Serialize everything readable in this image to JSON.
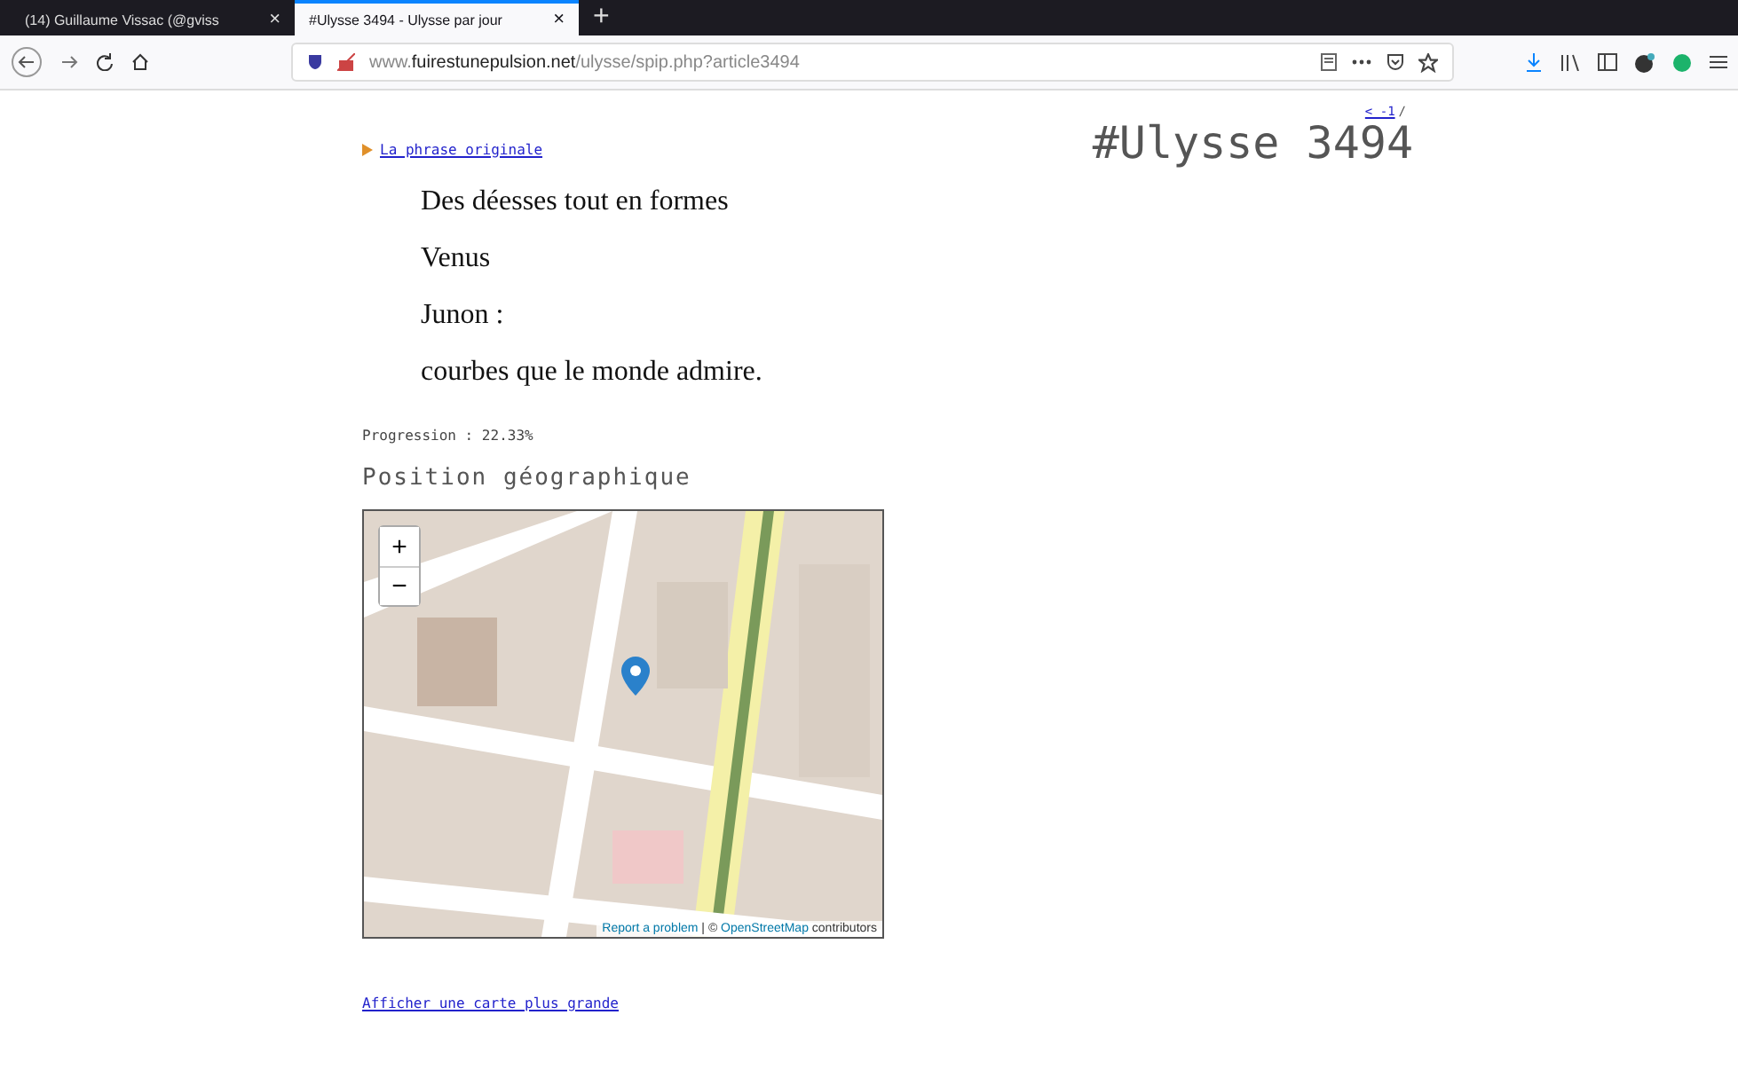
{
  "tabs": [
    {
      "label": "(14) Guillaume Vissac (@gviss",
      "selected": false,
      "close": "×"
    },
    {
      "label": "#Ulysse 3494 - Ulysse par jour",
      "selected": true,
      "close": "×"
    }
  ],
  "new_tab": "+",
  "address": {
    "domain_before": "www.",
    "domain": "fuirestunepulsion.net",
    "path": "/ulysse/spip.php?article3494"
  },
  "nav": {
    "prev": "< -1 ",
    "sep": "/"
  },
  "original_link": "La phrase originale",
  "title": "#Ulysse 3494",
  "lines": [
    "Des déesses tout en formes",
    "Venus",
    "Junon :",
    "courbes que le monde admire."
  ],
  "progress": "Progression : 22.33%",
  "geo_heading": "Position géographique",
  "map": {
    "kind": "picture",
    "zoom_in": "+",
    "zoom_out": "−",
    "report": "Report a problem",
    "separator": " | © ",
    "osm": "OpenStreetMap",
    "contributors": " contributors"
  },
  "bigger_map": "Afficher une carte plus grande"
}
